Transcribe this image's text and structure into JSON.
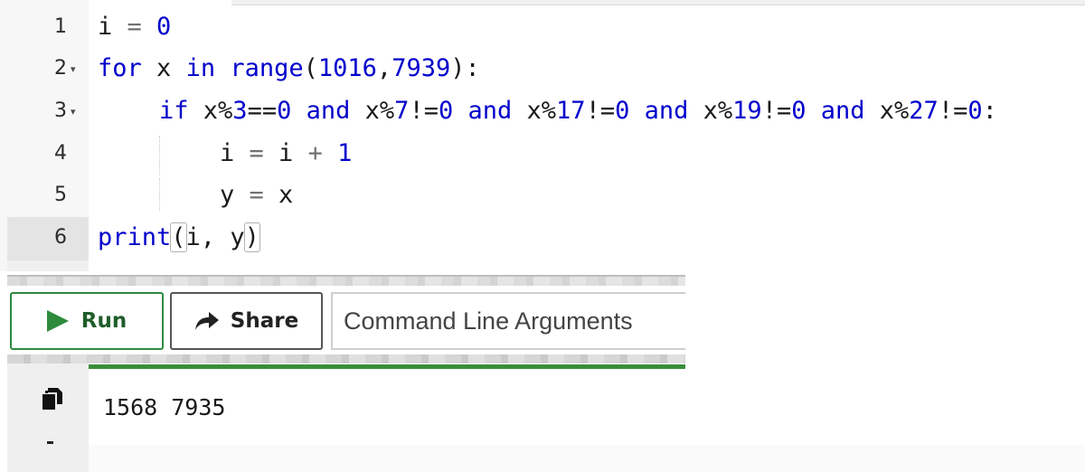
{
  "editor": {
    "lines": [
      {
        "number": "1",
        "tokens": [
          {
            "t": "i",
            "c": "id"
          },
          {
            "t": " = ",
            "c": "op"
          },
          {
            "t": "0",
            "c": "num"
          }
        ]
      },
      {
        "number": "2",
        "tokens": [
          {
            "t": "for",
            "c": "kw"
          },
          {
            "t": " x ",
            "c": "id"
          },
          {
            "t": "in",
            "c": "kw"
          },
          {
            "t": " ",
            "c": "id"
          },
          {
            "t": "range",
            "c": "kw"
          },
          {
            "t": "(",
            "c": "id"
          },
          {
            "t": "1016",
            "c": "num"
          },
          {
            "t": ",",
            "c": "id"
          },
          {
            "t": "7939",
            "c": "num"
          },
          {
            "t": "):",
            "c": "id"
          }
        ]
      },
      {
        "number": "3",
        "tokens": [
          {
            "t": "if",
            "c": "kw"
          },
          {
            "t": " x",
            "c": "id"
          },
          {
            "t": "%",
            "c": "id"
          },
          {
            "t": "3",
            "c": "num"
          },
          {
            "t": "==",
            "c": "id"
          },
          {
            "t": "0",
            "c": "num"
          },
          {
            "t": " ",
            "c": "id"
          },
          {
            "t": "and",
            "c": "kw"
          },
          {
            "t": " x%",
            "c": "id"
          },
          {
            "t": "7",
            "c": "num"
          },
          {
            "t": "!=",
            "c": "id"
          },
          {
            "t": "0",
            "c": "num"
          },
          {
            "t": " ",
            "c": "id"
          },
          {
            "t": "and",
            "c": "kw"
          },
          {
            "t": " x%",
            "c": "id"
          },
          {
            "t": "17",
            "c": "num"
          },
          {
            "t": "!=",
            "c": "id"
          },
          {
            "t": "0",
            "c": "num"
          },
          {
            "t": " ",
            "c": "id"
          },
          {
            "t": "and",
            "c": "kw"
          },
          {
            "t": " x%",
            "c": "id"
          },
          {
            "t": "19",
            "c": "num"
          },
          {
            "t": "!=",
            "c": "id"
          },
          {
            "t": "0",
            "c": "num"
          },
          {
            "t": " ",
            "c": "id"
          },
          {
            "t": "and",
            "c": "kw"
          },
          {
            "t": " x%",
            "c": "id"
          },
          {
            "t": "27",
            "c": "num"
          },
          {
            "t": "!=",
            "c": "id"
          },
          {
            "t": "0",
            "c": "num"
          },
          {
            "t": ":",
            "c": "id"
          }
        ]
      },
      {
        "number": "4",
        "tokens": [
          {
            "t": "i",
            "c": "id"
          },
          {
            "t": " = ",
            "c": "op"
          },
          {
            "t": "i",
            "c": "id"
          },
          {
            "t": " + ",
            "c": "op"
          },
          {
            "t": "1",
            "c": "num"
          }
        ]
      },
      {
        "number": "5",
        "tokens": [
          {
            "t": "y",
            "c": "id"
          },
          {
            "t": " = ",
            "c": "op"
          },
          {
            "t": "x",
            "c": "id"
          }
        ]
      },
      {
        "number": "6",
        "tokens": [
          {
            "t": "print",
            "c": "kw"
          },
          {
            "t": "(",
            "c": "brk"
          },
          {
            "t": "i, y",
            "c": "id"
          },
          {
            "t": ")",
            "c": "brk"
          }
        ]
      }
    ],
    "fold_marker": "▾",
    "colors": {
      "keyword": "#0000cc",
      "number": "#0000cc",
      "operator": "#707070",
      "text": "#1a1a1a"
    }
  },
  "toolbar": {
    "run_label": "Run",
    "share_label": "Share",
    "args_placeholder": "Command Line Arguments",
    "run_color": "#2e8b3e"
  },
  "output": {
    "text": "1568 7935"
  }
}
